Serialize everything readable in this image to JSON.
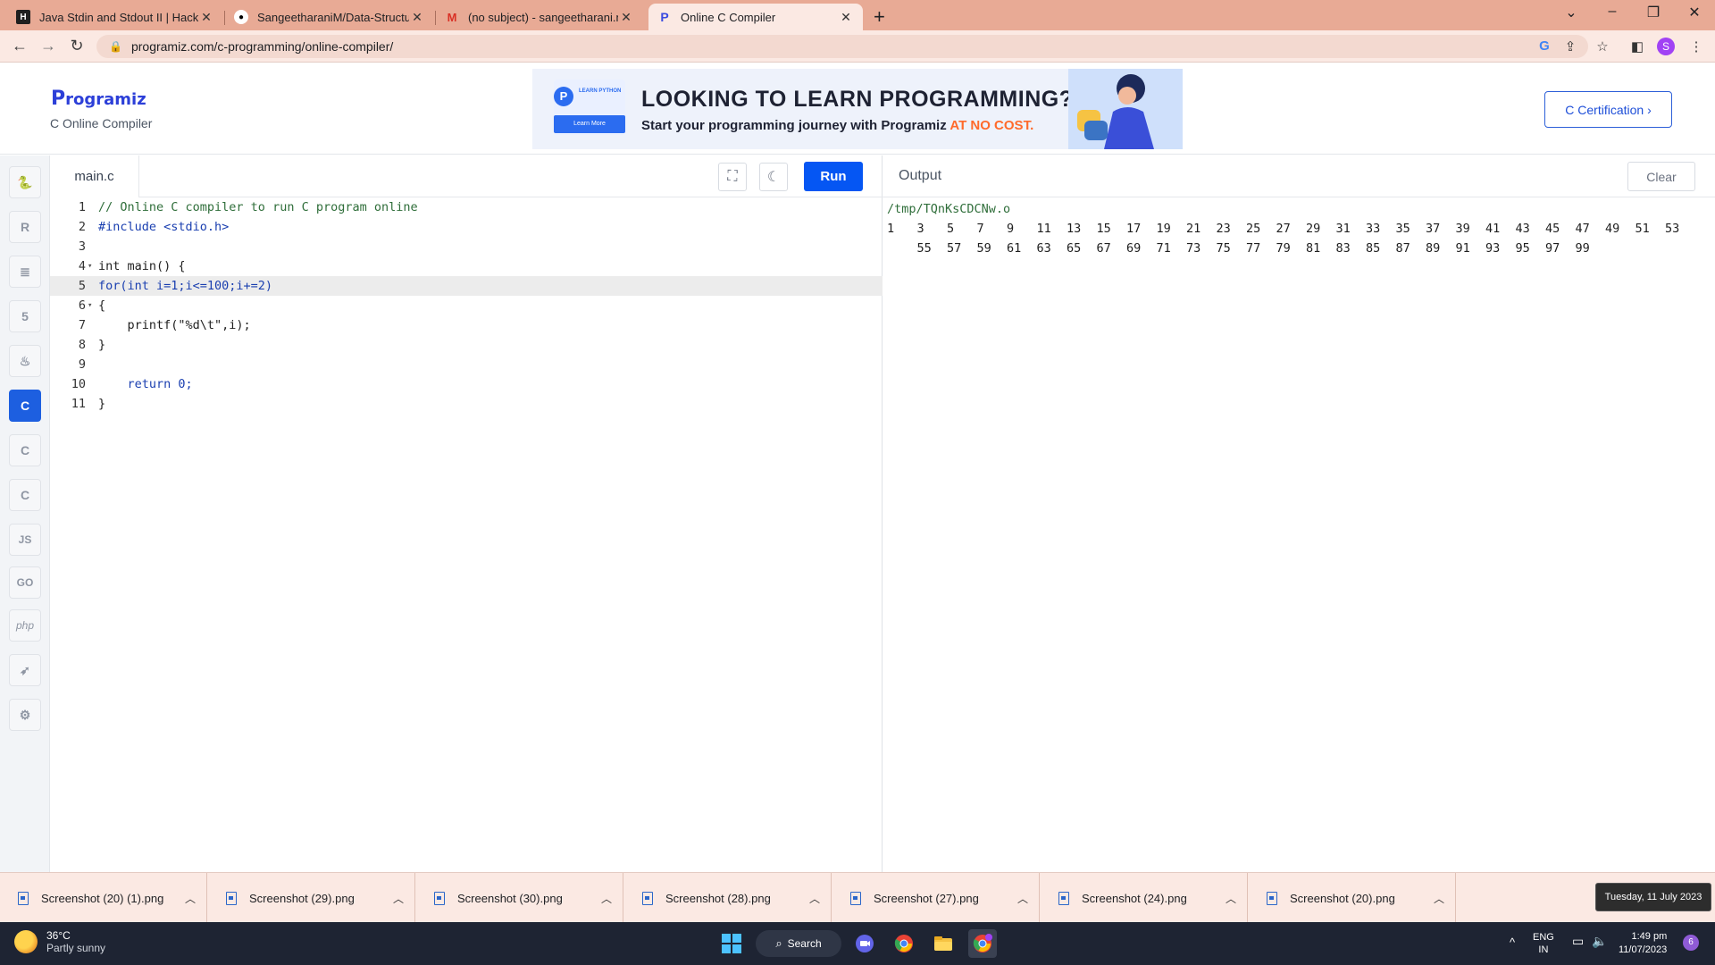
{
  "browser": {
    "tabs": [
      {
        "title": "Java Stdin and Stdout II | HackerR",
        "icon": "hackerrank-icon"
      },
      {
        "title": "SangeetharaniM/Data-Structure-",
        "icon": "github-icon"
      },
      {
        "title": "(no subject) - sangeetharani.m.20",
        "icon": "gmail-icon"
      },
      {
        "title": "Online C Compiler",
        "icon": "programiz-icon"
      }
    ],
    "url": "programiz.com/c-programming/online-compiler/",
    "profile_initial": "S"
  },
  "site": {
    "logo_text": "rogramiz",
    "logo_mark": "P",
    "subtitle": "C Online Compiler",
    "banner": {
      "heading": "LOOKING TO LEARN PROGRAMMING?",
      "sub_text": "Start your programming journey with Programiz",
      "sub_highlight": "AT NO COST.",
      "mini_top": "LEARN PYTHON",
      "mini_button": "Learn More"
    },
    "cert_button": "C Certification ›"
  },
  "sidebar": {
    "languages": [
      {
        "name": "python",
        "icon": "python-icon",
        "glyph": "🐍",
        "active": false
      },
      {
        "name": "r",
        "icon": "r-icon",
        "glyph": "R",
        "active": false
      },
      {
        "name": "sql",
        "icon": "database-icon",
        "glyph": "≣",
        "active": false
      },
      {
        "name": "html",
        "icon": "html5-icon",
        "glyph": "5",
        "active": false
      },
      {
        "name": "java",
        "icon": "java-icon",
        "glyph": "♨",
        "active": false
      },
      {
        "name": "c",
        "icon": "c-icon",
        "glyph": "C",
        "active": true
      },
      {
        "name": "cpp",
        "icon": "cpp-icon",
        "glyph": "C",
        "active": false
      },
      {
        "name": "csharp",
        "icon": "csharp-icon",
        "glyph": "C",
        "active": false
      },
      {
        "name": "javascript",
        "icon": "js-icon",
        "glyph": "JS",
        "active": false
      },
      {
        "name": "go",
        "icon": "go-icon",
        "glyph": "GO",
        "active": false
      },
      {
        "name": "php",
        "icon": "php-icon",
        "glyph": "php",
        "active": false
      },
      {
        "name": "swift",
        "icon": "swift-icon",
        "glyph": "➶",
        "active": false
      },
      {
        "name": "rust",
        "icon": "rust-icon",
        "glyph": "⚙",
        "active": false
      }
    ]
  },
  "editor": {
    "filename": "main.c",
    "run_label": "Run",
    "line_numbers": [
      "1",
      "2",
      "3",
      "4",
      "5",
      "6",
      "7",
      "8",
      "9",
      "10",
      "11"
    ],
    "lines": [
      {
        "text": "// Online C compiler to run C program online",
        "cls": "c-com",
        "fold": ""
      },
      {
        "text": "#include <stdio.h>",
        "cls": "c-kw",
        "fold": ""
      },
      {
        "text": "",
        "cls": "",
        "fold": ""
      },
      {
        "text": "int main() {",
        "cls": "",
        "fold": "▾"
      },
      {
        "text": "for(int i=1;i<=100;i+=2)",
        "cls": "c-kw",
        "fold": ""
      },
      {
        "text": "{",
        "cls": "",
        "fold": "▾"
      },
      {
        "text": "    printf(\"%d\\t\",i);",
        "cls": "",
        "fold": ""
      },
      {
        "text": "}",
        "cls": "",
        "fold": ""
      },
      {
        "text": "",
        "cls": "",
        "fold": ""
      },
      {
        "text": "    return 0;",
        "cls": "c-kw",
        "fold": ""
      },
      {
        "text": "}",
        "cls": "",
        "fold": ""
      }
    ],
    "current_line": 5
  },
  "output": {
    "title": "Output",
    "clear_label": "Clear",
    "path": "/tmp/TQnKsCDCNw.o",
    "row1": [
      "1",
      "3",
      "5",
      "7",
      "9",
      "11",
      "13",
      "15",
      "17",
      "19",
      "21",
      "23",
      "25",
      "27",
      "29",
      "31",
      "33",
      "35",
      "37",
      "39",
      "41",
      "43",
      "45",
      "47",
      "49",
      "51",
      "53"
    ],
    "row2": [
      "55",
      "57",
      "59",
      "61",
      "63",
      "65",
      "67",
      "69",
      "71",
      "73",
      "75",
      "77",
      "79",
      "81",
      "83",
      "85",
      "87",
      "89",
      "91",
      "93",
      "95",
      "97",
      "99"
    ]
  },
  "downloads": [
    "Screenshot (20) (1).png",
    "Screenshot (29).png",
    "Screenshot (30).png",
    "Screenshot (28).png",
    "Screenshot (27).png",
    "Screenshot (24).png",
    "Screenshot (20).png"
  ],
  "date_tooltip": "Tuesday, 11 July 2023",
  "taskbar": {
    "temperature": "36°C",
    "weather": "Partly sunny",
    "search_label": "Search",
    "lang_top": "ENG",
    "lang_bottom": "IN",
    "time": "1:49 pm",
    "date": "11/07/2023",
    "notifications": "6"
  }
}
